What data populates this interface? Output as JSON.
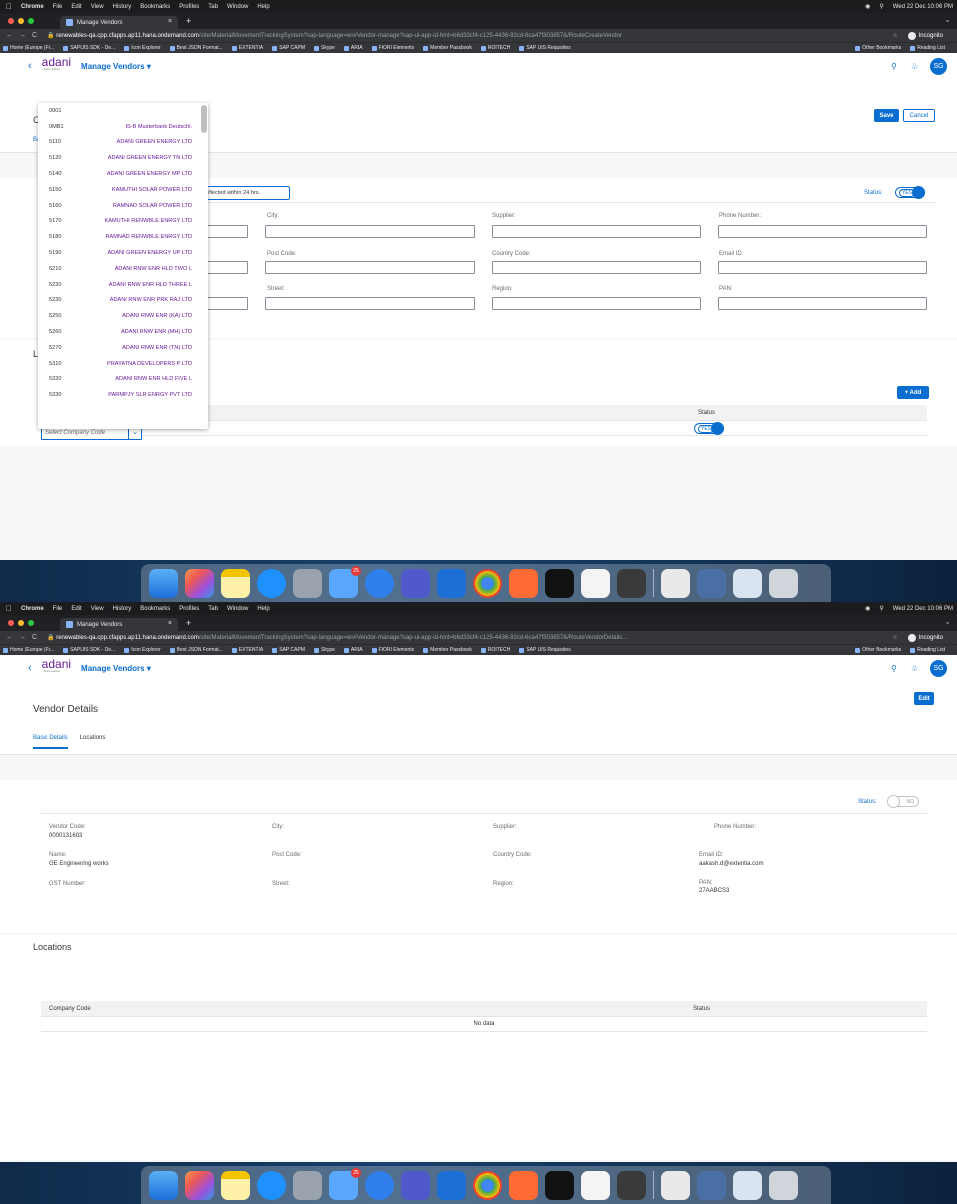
{
  "os_menubar": {
    "app": "Chrome",
    "menus": [
      "File",
      "Edit",
      "View",
      "History",
      "Bookmarks",
      "Profiles",
      "Tab",
      "Window",
      "Help"
    ],
    "datetime": "Wed 22 Dec 10:06 PM"
  },
  "browser": {
    "tab_title": "Manage Vendors",
    "url_host": "renewables-qa.cpp.cfapps.ap11.hana.ondemand.com",
    "url_path_a": "/site/MaterialMovementTrackingSystem?sap-language=en#Vendor-manage?sap-ui-app-id-hint=b6d33cf4-c125-4436-92cd-6ca47f303857&/RouteCreateVendor",
    "url_path_b": "/site/MaterialMovementTrackingSystem?sap-language=en#Vendor-manage?sap-ui-app-id-hint=b6d33cf4-c125-4436-92cd-6ca47f303857&/RouteVendorDetails...",
    "incognito_label": "Incognito",
    "bookmarks": [
      "Home (Europe (Fr...",
      "SAPUIS SDK - De...",
      "Icon Explorer",
      "Best JSON Format...",
      "EXTENTIA",
      "SAP CAPM",
      "Skype",
      "ARIA",
      "FIORI Elements",
      "Member Passbook",
      "ROITECH",
      "SAP UIS Requisites"
    ],
    "other_bookmarks": "Other Bookmarks",
    "reading_list": "Reading List"
  },
  "shell": {
    "logo_text": "adani",
    "logo_sub": "Renewables",
    "app_title": "Manage Vendors",
    "avatar_initials": "SG"
  },
  "create_screen": {
    "title_stub": "C",
    "tab_stub": "Ba",
    "save_label": "Save",
    "cancel_label": "Cancel",
    "info_text": "eflected within 24 hrs.",
    "status_label": "Status:",
    "status_toggle": "YES",
    "field_labels": {
      "city": "City:",
      "supplier": "Supplier:",
      "phone": "Phone Number:",
      "post_code": "Post Code:",
      "country_code": "Country Code:",
      "email": "Email ID:",
      "street": "Street:",
      "region": "Region:",
      "pan": "PAN:"
    },
    "locations_stub": "Lo",
    "add_button": "+ Add",
    "table_status_header": "Status",
    "row_status_toggle": "YES",
    "company_code_placeholder": "Select Company Code",
    "company_code_options": [
      {
        "code": "0001",
        "name": ""
      },
      {
        "code": "0MB1",
        "name": "IS-B Musterbank Deutschl."
      },
      {
        "code": "5110",
        "name": "ADANI GREEN ENERGY LTD"
      },
      {
        "code": "5120",
        "name": "ADANI GREEN ENERGY TN LTD"
      },
      {
        "code": "5140",
        "name": "ADANI GREEN ENERGY MP LTD"
      },
      {
        "code": "5150",
        "name": "KAMUTHI SOLAR POWER LTD"
      },
      {
        "code": "5160",
        "name": "RAMNAD SOLAR POWER LTD"
      },
      {
        "code": "5170",
        "name": "KAMUTHI RENWBLE ENRGY LTD"
      },
      {
        "code": "5180",
        "name": "RAMNAD RENWBLE ENRGY LTD"
      },
      {
        "code": "5190",
        "name": "ADANI GREEN ENERGY UP LTD"
      },
      {
        "code": "5210",
        "name": "ADANI RNW ENR HLD TWO L"
      },
      {
        "code": "5220",
        "name": "ADANI RNW ENR HLD THREE L"
      },
      {
        "code": "5230",
        "name": "ADANI RNW ENR PRK RAJ LTD"
      },
      {
        "code": "5250",
        "name": "ADANI RNW ENR (KA) LTD"
      },
      {
        "code": "5260",
        "name": "ADANI RNW ENR (MH) LTD"
      },
      {
        "code": "5270",
        "name": "ADANI RNW ENR (TN) LTD"
      },
      {
        "code": "5310",
        "name": "PRAYATNA DEVELOPERS P LTD"
      },
      {
        "code": "5320",
        "name": "ADANI RNW ENR HLD FIVE L"
      },
      {
        "code": "5330",
        "name": "PARMPJY SLR ENRGY PVT LTD"
      }
    ]
  },
  "details_screen": {
    "title": "Vendor Details",
    "edit_label": "Edit",
    "tabs": [
      "Basic Details",
      "Locations"
    ],
    "status_label": "Status:",
    "status_toggle": "NO",
    "fields": {
      "vendor_code_label": "Vendor Code:",
      "vendor_code_value": "0000131603",
      "city_label": "City:",
      "supplier_label": "Supplier:",
      "phone_label": "Phone Number:",
      "name_label": "Name:",
      "name_value": "GE Engineering works",
      "post_code_label": "Post Code:",
      "country_code_label": "Country Code:",
      "email_label": "Email ID:",
      "email_value": "aakash.d@extentia.com",
      "gst_label": "GST Number:",
      "street_label": "Street:",
      "region_label": "Region:",
      "pan_label": "PAN:",
      "pan_value": "27AABCS3"
    },
    "locations_title": "Locations",
    "table_headers": [
      "Company Code",
      "Status"
    ],
    "no_data": "No data"
  },
  "dock": {
    "mail_badge": "25"
  }
}
